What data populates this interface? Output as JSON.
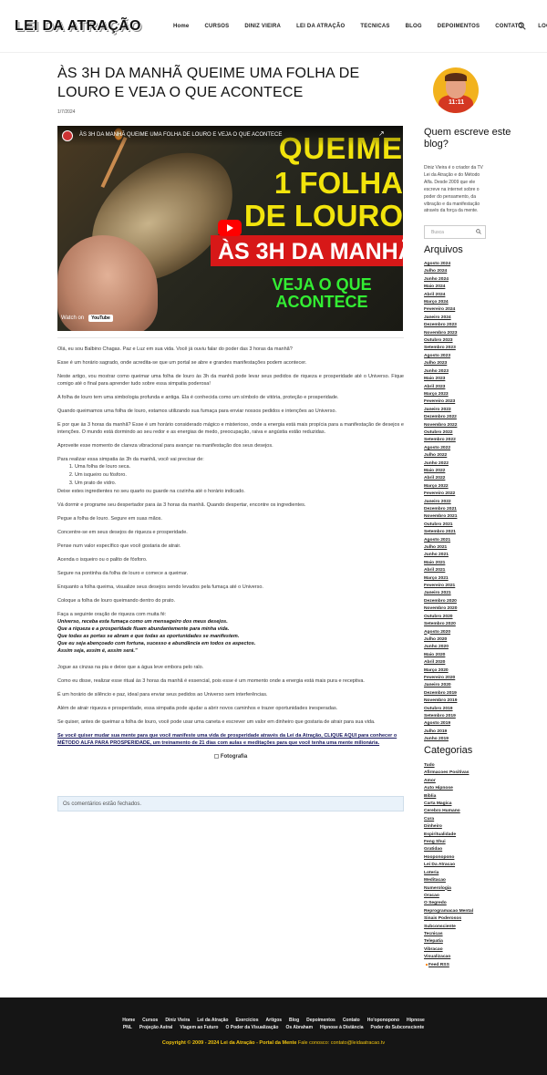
{
  "site": {
    "logo": "LEI DA ATRAÇÃO"
  },
  "nav": [
    {
      "label": "Home",
      "name": "nav-home"
    },
    {
      "label": "CURSOS",
      "name": "nav-cursos"
    },
    {
      "label": "DINIZ VIEIRA",
      "name": "nav-diniz-vieira"
    },
    {
      "label": "LEI DA ATRAÇÃO",
      "name": "nav-lei-da-atracao"
    },
    {
      "label": "TECNICAS",
      "name": "nav-tecnicas"
    },
    {
      "label": "BLOG",
      "name": "nav-blog"
    },
    {
      "label": "DEPOIMENTOS",
      "name": "nav-depoimentos"
    },
    {
      "label": "CONTATO",
      "name": "nav-contato"
    },
    {
      "label": "LOGIN",
      "name": "nav-login"
    }
  ],
  "post": {
    "title": "ÀS 3H DA MANHÃ QUEIME UMA FOLHA DE LOURO E VEJA O QUE ACONTECE",
    "date": "1/7/2024",
    "video": {
      "title": "ÀS 3H DA MANHÃ QUEIME UMA FOLHA DE LOURO E VEJA O QUE ACONTECE",
      "watch_on": "Watch on",
      "youtube": "YouTube",
      "thumb_line1": "QUEIME",
      "thumb_line2": "1 FOLHA",
      "thumb_line3": "DE LOURO",
      "thumb_line4": "ÀS 3H DA MANHÃ",
      "thumb_line5": "VEJA O QUE ACONTECE"
    },
    "paragraphs": {
      "p1": "Olá, eu sou Balbino Chagas. Paz e Luz em sua vida. Você já ouviu falar do poder das 3 horas da manhã?",
      "p2": "Esse é um horário sagrado, onde acredita-se que um portal se abre e grandes manifestações podem acontecer.",
      "p3": "Neste artigo, vou mostrar como queimar uma folha de louro às 3h da manhã pode levar seus pedidos de riqueza e prosperidade até o Universo. Fique comigo até o final para aprender tudo sobre essa simpatia poderosa!",
      "p4": "A folha de louro tem uma simbologia profunda e antiga. Ela é conhecida como um símbolo de vitória, proteção e prosperidade.",
      "p5": "Quando queimamos uma folha de louro, estamos utilizando sua fumaça para enviar nossos pedidos e intenções ao Universo.",
      "p6": "E por que às 3 horas da manhã? Esse é um horário considerado mágico e misterioso, onde a energia está mais propícia para a manifestação de desejos e intenções. O mundo está dormindo ao seu redor e as energias de medo, preocupação, raiva e angústia estão reduzidas.",
      "p7": "Aproveite esse momento de clareza vibracional para avançar na manifestação dos seus desejos.",
      "p8": "Para realizar essa simpatia às 3h da manhã, você vai precisar de:",
      "list": [
        "Uma folha de louro seca.",
        "Um isqueiro ou fósforo.",
        "Um prato de vidro."
      ],
      "p9": "Deixe estes ingredientes no seu quarto ou guarde na cozinha até o horário indicado.",
      "p10": "Vá dormir e programe seu despertador para às 3 horas da manhã. Quando despertar, encontre os ingredientes.",
      "p11": "Pegue a folha de louro. Segure em suas mãos.",
      "p12": "Concentre-se em seus desejos de riqueza e prosperidade.",
      "p13": "Pense num valor específico que você gostaria de atrair.",
      "p14": "Acenda o isqueiro ou o palito de fósforo.",
      "p15": "Segure na pontinha da folha de louro e comece a queimar.",
      "p16": "Enquanto a folha queima, visualize seus desejos sendo levados pela fumaça até o Universo.",
      "p17": "Coloque a folha de louro queimando dentro do prato.",
      "p18": "Faça a seguinte oração de riqueza com muita fé:",
      "prayer": [
        "Universo, receba esta fumaça como um mensageiro dos meus desejos.",
        "Que a riqueza e a prosperidade fluam abundantemente para minha vida.",
        "Que todas as portas se abram e que todas as oportunidades se manifestem.",
        "Que eu seja abençoado com fortuna, sucesso e abundância em todos os aspectos.",
        "Assim seja, assim é, assim será.\""
      ],
      "p19": "Jogue as cinzas na pia e deixe que a água leve embora pelo ralo.",
      "p20": "Como eu disse, realizar esse ritual às 3 horas da manhã é essencial, pois esse é um momento onde a energia está mais pura e receptiva.",
      "p21": "É um horário de silêncio e paz, ideal para enviar seus pedidos ao Universo sem interferências.",
      "p22": "Além de atrair riqueza e prosperidade, essa simpatia pode ajudar a abrir novos caminhos e trazer oportunidades inesperadas.",
      "p23": "Se quiser, antes de queimar a folha de louro, você pode usar uma caneta e escrever um valor em dinheiro que gostaria de atrair para sua vida.",
      "cta": "Se você quiser mudar sua mente para que você manifeste uma vida de prosperidade através da Lei da Atração, CLIQUE AQUI para conhecer o MÉTODO ALFA PARA PROSPERIDADE, um treinamento de 21 dias com aulas e meditações para que você tenha uma mente milionária.",
      "image_alt": "Fotografia"
    },
    "comments_closed": "Os comentários estão fechados."
  },
  "sidebar": {
    "author_badge": "11:11",
    "author_title": "Quem escreve este blog?",
    "author_bio": "Diniz Vieira é o criador da TV Lei da Atração e do Método Alfa. Desde 2009 que ele escreve na internet sobre o poder do pensamento, da vibração e da manifestação através da força da mente.",
    "search_placeholder": "Busca",
    "archives_title": "Arquivos",
    "archives": [
      "Agosto 2024",
      "Julho 2024",
      "Junho 2024",
      "Maio 2024",
      "Abril 2024",
      "Março 2024",
      "Fevereiro 2024",
      "Janeiro 2024",
      "Dezembro 2023",
      "Novembro 2023",
      "Outubro 2023",
      "Setembro 2023",
      "Agosto 2023",
      "Julho 2023",
      "Junho 2023",
      "Maio 2023",
      "Abril 2023",
      "Março 2023",
      "Fevereiro 2023",
      "Janeiro 2023",
      "Dezembro 2022",
      "Novembro 2022",
      "Outubro 2022",
      "Setembro 2022",
      "Agosto 2022",
      "Julho 2022",
      "Junho 2022",
      "Maio 2022",
      "Abril 2022",
      "Março 2022",
      "Fevereiro 2022",
      "Janeiro 2022",
      "Dezembro 2021",
      "Novembro 2021",
      "Outubro 2021",
      "Setembro 2021",
      "Agosto 2021",
      "Julho 2021",
      "Junho 2021",
      "Maio 2021",
      "Abril 2021",
      "Março 2021",
      "Fevereiro 2021",
      "Janeiro 2021",
      "Dezembro 2020",
      "Novembro 2020",
      "Outubro 2020",
      "Setembro 2020",
      "Agosto 2020",
      "Julho 2020",
      "Junho 2020",
      "Maio 2020",
      "Abril 2020",
      "Março 2020",
      "Fevereiro 2020",
      "Janeiro 2020",
      "Dezembro 2019",
      "Novembro 2019",
      "Outubro 2019",
      "Setembro 2019",
      "Agosto 2019",
      "Julho 2019",
      "Junho 2019"
    ],
    "categories_title": "Categorias",
    "categories": [
      "Tudo",
      "Afirmacoes Positivas",
      "Amor",
      "Auto Hipnose",
      "Bíblia",
      "Carta Magica",
      "Cerebro Humano",
      "Cura",
      "Dinheiro",
      "Espiritualidade",
      "Feng Shui",
      "Gratidao",
      "Hooponopono",
      "Lei Da Atracao",
      "Loteria",
      "Meditacao",
      "Numerologia",
      "Oracao",
      "O Segredo",
      "Reprogramacao Mental",
      "Sinais Poderosos",
      "Subconsciente",
      "Tecnicas",
      "Telepatia",
      "Vibracao",
      "Visualizacao"
    ],
    "feed": "Feed RSS"
  },
  "footer": {
    "row1": [
      "Home",
      "Cursos",
      "Diniz Vieira",
      "Lei da Atração",
      "Exercícios",
      "Artigos",
      "Blog",
      "Depoimentos",
      "Contato",
      "Ho'oponopono",
      "Hipnose"
    ],
    "row2": [
      "PNL",
      "Projeção Astral",
      "Viagem ao Futuro",
      "O Poder da Visualização",
      "Os Abraham",
      "Hipnose à Distância",
      "Poder do Subconsciente"
    ],
    "copyright": "Copyright © 2009 - 2024 Lei da Atração - Portal da Mente",
    "contact_label": "Fale conosco:",
    "email": "contato@leidaatracao.tv"
  },
  "colors": {
    "accent_yellow": "#f1c40f",
    "footer_bg": "#151515",
    "thumb_red": "#d71818",
    "thumb_green": "#33ee33"
  }
}
